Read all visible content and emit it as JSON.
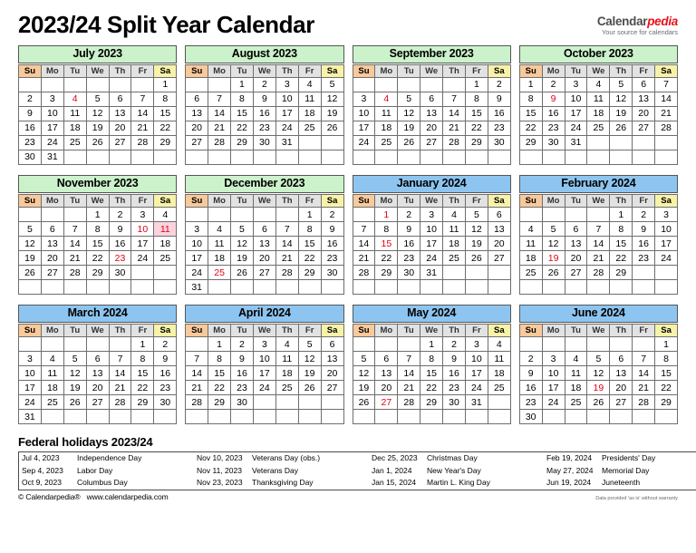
{
  "header": {
    "title": "2023/24 Split Year Calendar",
    "brand_main": "Calendar",
    "brand_accent": "pedia",
    "brand_sub": "Your source for calendars"
  },
  "colors": {
    "header_2023": "#ccf2cc",
    "header_2024": "#8ec5f0",
    "sunday": "#f8c99a",
    "saturday": "#fcf7c8",
    "holiday_bg": "#fdd3dd",
    "holiday_text": "#e20015",
    "dow_header": "#e2e2e2",
    "brand_accent": "#e8131a"
  },
  "weekday_headers": [
    "Su",
    "Mo",
    "Tu",
    "We",
    "Th",
    "Fr",
    "Sa"
  ],
  "months": [
    {
      "name": "July 2023",
      "year_class": "y2023",
      "weeks": [
        [
          "",
          "",
          "",
          "",
          "",
          "",
          "1"
        ],
        [
          "2",
          "3",
          "4",
          "5",
          "6",
          "7",
          "8"
        ],
        [
          "9",
          "10",
          "11",
          "12",
          "13",
          "14",
          "15"
        ],
        [
          "16",
          "17",
          "18",
          "19",
          "20",
          "21",
          "22"
        ],
        [
          "23",
          "24",
          "25",
          "26",
          "27",
          "28",
          "29"
        ],
        [
          "30",
          "31",
          "",
          "",
          "",
          "",
          ""
        ]
      ],
      "holidays": [
        "4"
      ]
    },
    {
      "name": "August 2023",
      "year_class": "y2023",
      "weeks": [
        [
          "",
          "",
          "1",
          "2",
          "3",
          "4",
          "5"
        ],
        [
          "6",
          "7",
          "8",
          "9",
          "10",
          "11",
          "12"
        ],
        [
          "13",
          "14",
          "15",
          "16",
          "17",
          "18",
          "19"
        ],
        [
          "20",
          "21",
          "22",
          "23",
          "24",
          "25",
          "26"
        ],
        [
          "27",
          "28",
          "29",
          "30",
          "31",
          "",
          ""
        ],
        [
          "",
          "",
          "",
          "",
          "",
          "",
          ""
        ]
      ],
      "holidays": []
    },
    {
      "name": "September 2023",
      "year_class": "y2023",
      "weeks": [
        [
          "",
          "",
          "",
          "",
          "",
          "1",
          "2"
        ],
        [
          "3",
          "4",
          "5",
          "6",
          "7",
          "8",
          "9"
        ],
        [
          "10",
          "11",
          "12",
          "13",
          "14",
          "15",
          "16"
        ],
        [
          "17",
          "18",
          "19",
          "20",
          "21",
          "22",
          "23"
        ],
        [
          "24",
          "25",
          "26",
          "27",
          "28",
          "29",
          "30"
        ],
        [
          "",
          "",
          "",
          "",
          "",
          "",
          ""
        ]
      ],
      "holidays": [
        "4"
      ]
    },
    {
      "name": "October 2023",
      "year_class": "y2023",
      "weeks": [
        [
          "1",
          "2",
          "3",
          "4",
          "5",
          "6",
          "7"
        ],
        [
          "8",
          "9",
          "10",
          "11",
          "12",
          "13",
          "14"
        ],
        [
          "15",
          "16",
          "17",
          "18",
          "19",
          "20",
          "21"
        ],
        [
          "22",
          "23",
          "24",
          "25",
          "26",
          "27",
          "28"
        ],
        [
          "29",
          "30",
          "31",
          "",
          "",
          "",
          ""
        ],
        [
          "",
          "",
          "",
          "",
          "",
          "",
          ""
        ]
      ],
      "holidays": [
        "9"
      ]
    },
    {
      "name": "November 2023",
      "year_class": "y2023",
      "weeks": [
        [
          "",
          "",
          "",
          "1",
          "2",
          "3",
          "4"
        ],
        [
          "5",
          "6",
          "7",
          "8",
          "9",
          "10",
          "11"
        ],
        [
          "12",
          "13",
          "14",
          "15",
          "16",
          "17",
          "18"
        ],
        [
          "19",
          "20",
          "21",
          "22",
          "23",
          "24",
          "25"
        ],
        [
          "26",
          "27",
          "28",
          "29",
          "30",
          "",
          ""
        ],
        [
          "",
          "",
          "",
          "",
          "",
          "",
          ""
        ]
      ],
      "holidays": [
        "10",
        "11",
        "23"
      ]
    },
    {
      "name": "December 2023",
      "year_class": "y2023",
      "weeks": [
        [
          "",
          "",
          "",
          "",
          "",
          "1",
          "2"
        ],
        [
          "3",
          "4",
          "5",
          "6",
          "7",
          "8",
          "9"
        ],
        [
          "10",
          "11",
          "12",
          "13",
          "14",
          "15",
          "16"
        ],
        [
          "17",
          "18",
          "19",
          "20",
          "21",
          "22",
          "23"
        ],
        [
          "24",
          "25",
          "26",
          "27",
          "28",
          "29",
          "30"
        ],
        [
          "31",
          "",
          "",
          "",
          "",
          "",
          ""
        ]
      ],
      "holidays": [
        "25"
      ]
    },
    {
      "name": "January 2024",
      "year_class": "y2024",
      "weeks": [
        [
          "",
          "1",
          "2",
          "3",
          "4",
          "5",
          "6"
        ],
        [
          "7",
          "8",
          "9",
          "10",
          "11",
          "12",
          "13"
        ],
        [
          "14",
          "15",
          "16",
          "17",
          "18",
          "19",
          "20"
        ],
        [
          "21",
          "22",
          "23",
          "24",
          "25",
          "26",
          "27"
        ],
        [
          "28",
          "29",
          "30",
          "31",
          "",
          "",
          ""
        ],
        [
          "",
          "",
          "",
          "",
          "",
          "",
          ""
        ]
      ],
      "holidays": [
        "1",
        "15"
      ]
    },
    {
      "name": "February 2024",
      "year_class": "y2024",
      "weeks": [
        [
          "",
          "",
          "",
          "",
          "1",
          "2",
          "3"
        ],
        [
          "4",
          "5",
          "6",
          "7",
          "8",
          "9",
          "10"
        ],
        [
          "11",
          "12",
          "13",
          "14",
          "15",
          "16",
          "17"
        ],
        [
          "18",
          "19",
          "20",
          "21",
          "22",
          "23",
          "24"
        ],
        [
          "25",
          "26",
          "27",
          "28",
          "29",
          "",
          ""
        ],
        [
          "",
          "",
          "",
          "",
          "",
          "",
          ""
        ]
      ],
      "holidays": [
        "19"
      ]
    },
    {
      "name": "March 2024",
      "year_class": "y2024",
      "weeks": [
        [
          "",
          "",
          "",
          "",
          "",
          "1",
          "2"
        ],
        [
          "3",
          "4",
          "5",
          "6",
          "7",
          "8",
          "9"
        ],
        [
          "10",
          "11",
          "12",
          "13",
          "14",
          "15",
          "16"
        ],
        [
          "17",
          "18",
          "19",
          "20",
          "21",
          "22",
          "23"
        ],
        [
          "24",
          "25",
          "26",
          "27",
          "28",
          "29",
          "30"
        ],
        [
          "31",
          "",
          "",
          "",
          "",
          "",
          ""
        ]
      ],
      "holidays": []
    },
    {
      "name": "April 2024",
      "year_class": "y2024",
      "weeks": [
        [
          "",
          "1",
          "2",
          "3",
          "4",
          "5",
          "6"
        ],
        [
          "7",
          "8",
          "9",
          "10",
          "11",
          "12",
          "13"
        ],
        [
          "14",
          "15",
          "16",
          "17",
          "18",
          "19",
          "20"
        ],
        [
          "21",
          "22",
          "23",
          "24",
          "25",
          "26",
          "27"
        ],
        [
          "28",
          "29",
          "30",
          "",
          "",
          "",
          ""
        ],
        [
          "",
          "",
          "",
          "",
          "",
          "",
          ""
        ]
      ],
      "holidays": []
    },
    {
      "name": "May 2024",
      "year_class": "y2024",
      "weeks": [
        [
          "",
          "",
          "",
          "1",
          "2",
          "3",
          "4"
        ],
        [
          "5",
          "6",
          "7",
          "8",
          "9",
          "10",
          "11"
        ],
        [
          "12",
          "13",
          "14",
          "15",
          "16",
          "17",
          "18"
        ],
        [
          "19",
          "20",
          "21",
          "22",
          "23",
          "24",
          "25"
        ],
        [
          "26",
          "27",
          "28",
          "29",
          "30",
          "31",
          ""
        ],
        [
          "",
          "",
          "",
          "",
          "",
          "",
          ""
        ]
      ],
      "holidays": [
        "27"
      ]
    },
    {
      "name": "June 2024",
      "year_class": "y2024",
      "weeks": [
        [
          "",
          "",
          "",
          "",
          "",
          "",
          "1"
        ],
        [
          "2",
          "3",
          "4",
          "5",
          "6",
          "7",
          "8"
        ],
        [
          "9",
          "10",
          "11",
          "12",
          "13",
          "14",
          "15"
        ],
        [
          "16",
          "17",
          "18",
          "19",
          "20",
          "21",
          "22"
        ],
        [
          "23",
          "24",
          "25",
          "26",
          "27",
          "28",
          "29"
        ],
        [
          "30",
          "",
          "",
          "",
          "",
          "",
          ""
        ]
      ],
      "holidays": [
        "19"
      ]
    }
  ],
  "holidays_section": {
    "title": "Federal holidays 2023/24",
    "rows": [
      [
        {
          "date": "Jul 4, 2023",
          "name": "Independence Day"
        },
        {
          "date": "Nov 10, 2023",
          "name": "Veterans Day (obs.)"
        },
        {
          "date": "Dec 25, 2023",
          "name": "Christmas Day"
        },
        {
          "date": "Feb 19, 2024",
          "name": "Presidents' Day"
        }
      ],
      [
        {
          "date": "Sep 4, 2023",
          "name": "Labor Day"
        },
        {
          "date": "Nov 11, 2023",
          "name": "Veterans Day"
        },
        {
          "date": "Jan 1, 2024",
          "name": "New Year's Day"
        },
        {
          "date": "May 27, 2024",
          "name": "Memorial Day"
        }
      ],
      [
        {
          "date": "Oct 9, 2023",
          "name": "Columbus Day"
        },
        {
          "date": "Nov 23, 2023",
          "name": "Thanksgiving Day"
        },
        {
          "date": "Jan 15, 2024",
          "name": "Martin L. King Day"
        },
        {
          "date": "Jun 19, 2024",
          "name": "Juneteenth"
        }
      ]
    ]
  },
  "footer": {
    "copyright": "© Calendarpedia®",
    "url": "www.calendarpedia.com",
    "disclaimer": "Data provided 'as is' without warranty"
  }
}
